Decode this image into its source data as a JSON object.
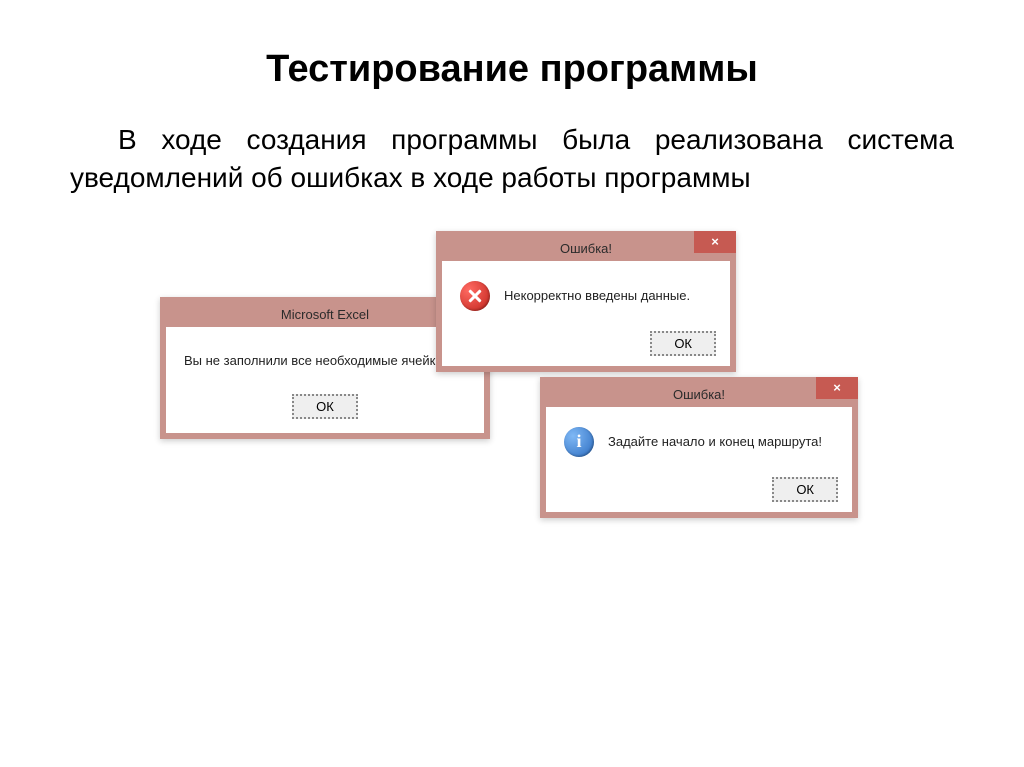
{
  "title": "Тестирование программы",
  "description": "В ходе создания программы была реализована система уведомлений об ошибках в ходе работы программы",
  "dialogs": {
    "excel": {
      "title": "Microsoft Excel",
      "message": "Вы не заполнили все необходимые ячейки",
      "ok": "ОК"
    },
    "error": {
      "title": "Ошибка!",
      "message": "Некорректно введены данные.",
      "ok": "ОК",
      "close": "×"
    },
    "info": {
      "title": "Ошибка!",
      "message": "Задайте начало и конец маршрута!",
      "ok": "ОК",
      "close": "×"
    }
  }
}
